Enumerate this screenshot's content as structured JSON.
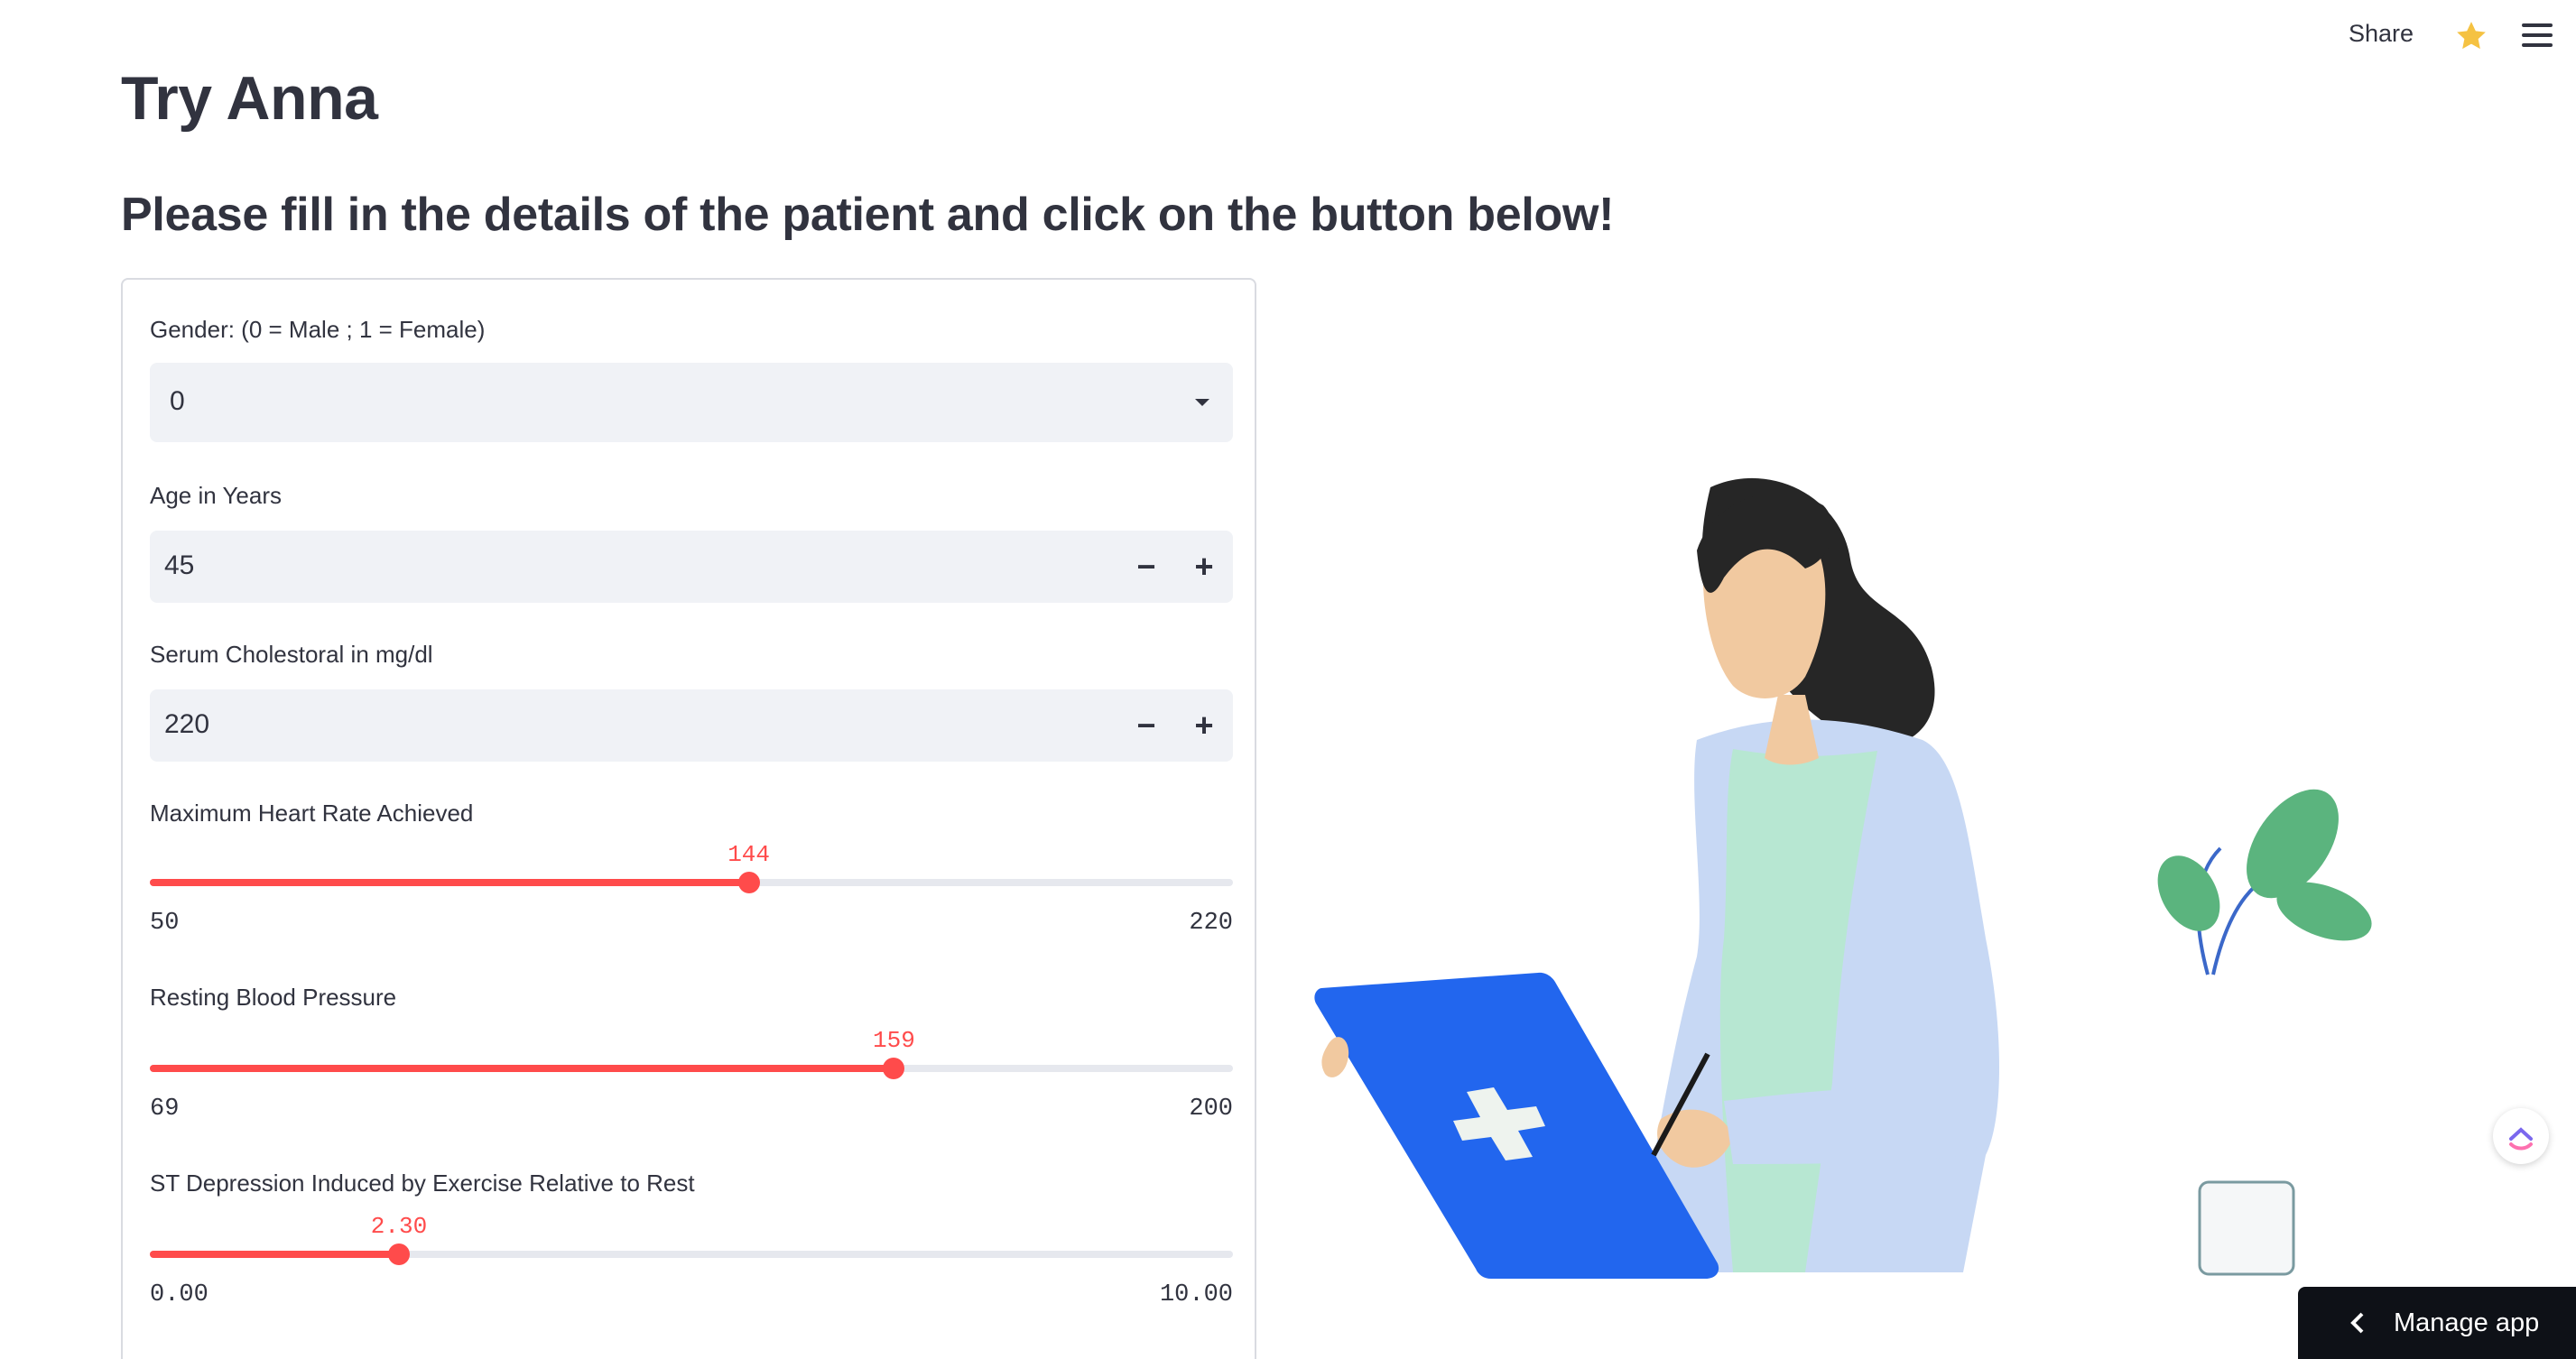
{
  "header": {
    "share_label": "Share",
    "icons": [
      "star-icon",
      "menu-icon"
    ],
    "accent_star": "#f5c242"
  },
  "page": {
    "title": "Try Anna",
    "subtitle": "Please fill in the details of the patient and click on the button below!"
  },
  "form": {
    "gender": {
      "label": "Gender: (0 = Male ; 1 = Female)",
      "value": "0"
    },
    "age": {
      "label": "Age in Years",
      "value": "45"
    },
    "cholesterol": {
      "label": "Serum Cholestoral in mg/dl",
      "value": "220"
    },
    "max_heart_rate": {
      "label": "Maximum Heart Rate Achieved",
      "value": "144",
      "min": "50",
      "max": "220",
      "fraction": 0.553
    },
    "resting_bp": {
      "label": "Resting Blood Pressure",
      "value": "159",
      "min": "69",
      "max": "200",
      "fraction": 0.687
    },
    "st_depression": {
      "label": "ST Depression Induced by Exercise Relative to Rest",
      "value": "2.30",
      "min": "0.00",
      "max": "10.00",
      "fraction": 0.23
    },
    "stepper": {
      "minus": "−",
      "plus": "+"
    }
  },
  "colors": {
    "slider_accent": "#ff4b4b",
    "input_bg": "#f0f2f6",
    "text": "#31333f",
    "manage_bg": "#0e1117"
  },
  "footer": {
    "manage_app_label": "Manage app"
  }
}
